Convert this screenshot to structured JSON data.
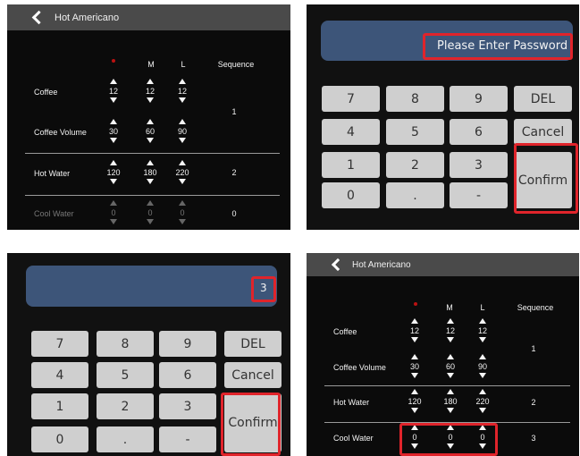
{
  "recipe": {
    "title": "Hot Americano",
    "columns": [
      "M",
      "L",
      "Sequence"
    ],
    "small_marker": "",
    "rows": [
      {
        "label": "Coffee",
        "values": [
          "12",
          "12",
          "12"
        ],
        "sequence": ""
      },
      {
        "label": "Coffee Volume",
        "values": [
          "30",
          "60",
          "90"
        ],
        "sequence": "1"
      },
      {
        "label": "Hot Water",
        "values": [
          "120",
          "180",
          "220"
        ],
        "sequence": "2"
      },
      {
        "label": "Cool Water",
        "values": [
          "0",
          "0",
          "0"
        ],
        "sequence_before": "0",
        "sequence_after": "3"
      }
    ]
  },
  "password_screen": {
    "placeholder": "Please Enter Password",
    "entered_value": "3",
    "keys": [
      "7",
      "8",
      "9",
      "DEL",
      "4",
      "5",
      "6",
      "Cancel",
      "1",
      "2",
      "3",
      "Confirm",
      "0",
      ".",
      "-"
    ]
  },
  "colors": {
    "highlight": "#e0242b",
    "display": "#3d5579",
    "key": "#cfcfcf",
    "titlebar": "#4a4a4a"
  }
}
